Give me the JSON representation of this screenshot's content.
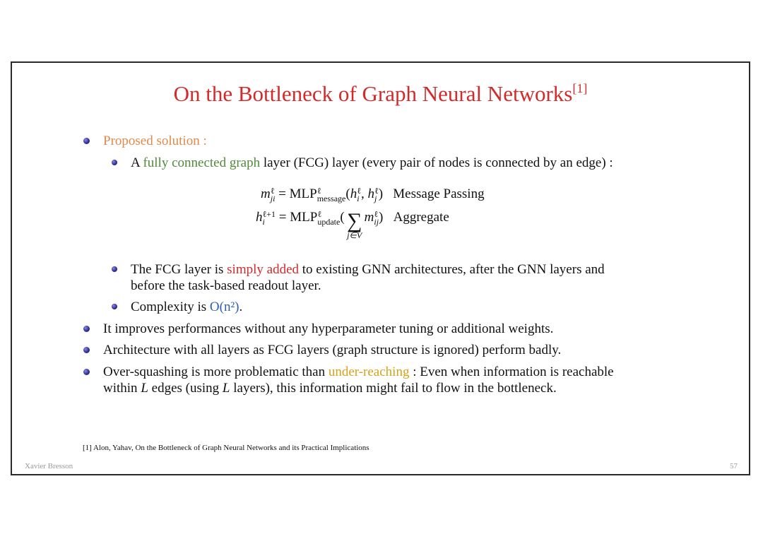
{
  "slide": {
    "title": "On the Bottleneck of Graph Neural Networks",
    "title_citation": "[1]",
    "colors": {
      "title": "#d42a2a",
      "bullet": "#2f2f9a",
      "proposed_solution": "#e08a4a",
      "fully_connected_graph": "#4f8a3a",
      "simply_added": "#d42a2a",
      "complexity": "#2d5fb0",
      "under_reaching": "#d8a21a"
    },
    "bullets": {
      "proposed": "Proposed solution :",
      "fcg_prefix": "A ",
      "fcg_highlight": "fully connected graph",
      "fcg_suffix": " layer (FCG) layer (every pair of nodes is connected by an edge) :",
      "equations": {
        "eq1_lhs": "m",
        "eq1_lhs_sup": "ℓ",
        "eq1_lhs_sub": "ji",
        "eq1_mlp": "= MLP",
        "eq1_mlp_sup": "ℓ",
        "eq1_mlp_sub": "message",
        "eq1_args": "(h",
        "eq1_args_a_sup": "ℓ",
        "eq1_args_a_sub": "i",
        "eq1_args_mid": ", h",
        "eq1_args_b_sup": "ℓ",
        "eq1_args_b_sub": "j",
        "eq1_close": ")",
        "eq1_label": "Message Passing",
        "eq2_lhs": "h",
        "eq2_lhs_sup": "ℓ+1",
        "eq2_lhs_sub": "i",
        "eq2_mlp": "= MLP",
        "eq2_mlp_sup": "ℓ",
        "eq2_mlp_sub": "update",
        "eq2_open": "(",
        "eq2_sigma": "∑",
        "eq2_sum_under": "j∈V",
        "eq2_term": "m",
        "eq2_term_sup": "ℓ",
        "eq2_term_sub": "ij",
        "eq2_close": ")",
        "eq2_label": "Aggregate"
      },
      "added_prefix": "The FCG layer is ",
      "added_highlight": "simply added",
      "added_suffix": " to existing GNN architectures, after the GNN layers and",
      "added_line2": "before the task-based readout layer.",
      "complexity_prefix": "Complexity is ",
      "complexity_value": "O(n²)",
      "complexity_suffix": ".",
      "improves": "It improves performances without any hyperparameter tuning or additional weights.",
      "architecture": "Architecture with all layers as FCG layers (graph structure is ignored) perform badly.",
      "oversq_prefix": "Over-squashing is more problematic than ",
      "oversq_highlight": "under-reaching",
      "oversq_suffix": " : Even when information is reachable",
      "oversq_line2_a": "within ",
      "oversq_line2_L1": "L",
      "oversq_line2_b": " edges (using ",
      "oversq_line2_L2": "L",
      "oversq_line2_c": " layers), this information might fail to flow in the bottleneck."
    },
    "footnote": "[1] Alon, Yahav, On the Bottleneck of Graph Neural Networks and its Practical Implications",
    "author": "Xavier Bresson",
    "page_number": "57"
  }
}
